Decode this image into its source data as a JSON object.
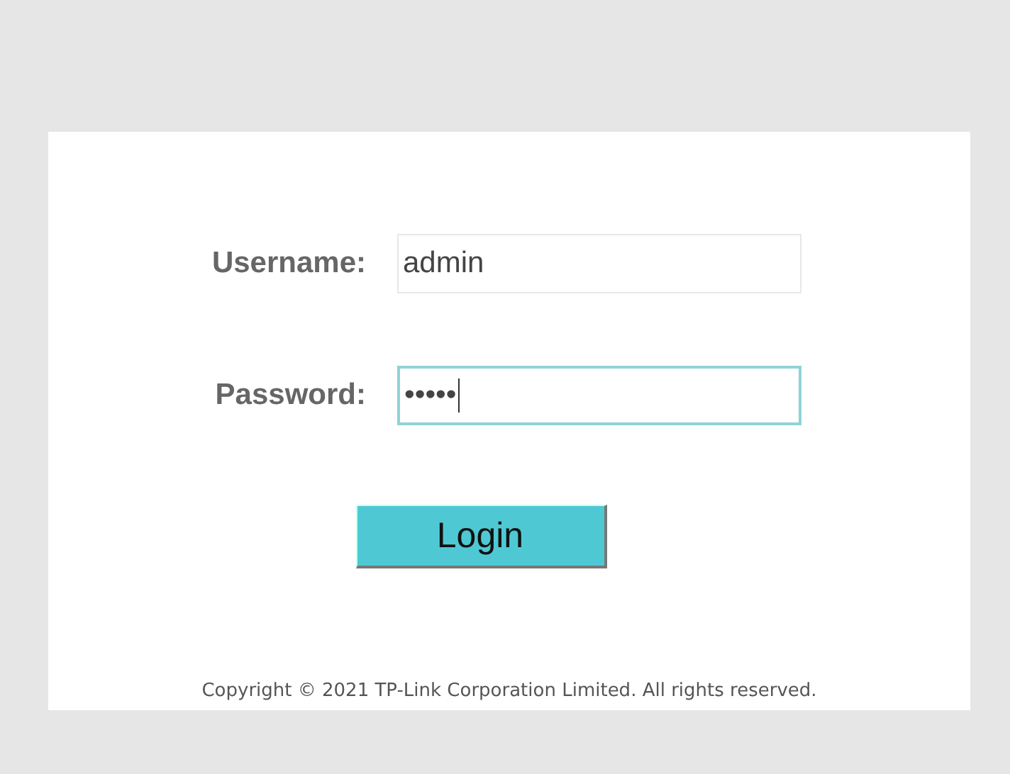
{
  "form": {
    "fields": [
      {
        "label": "Username:",
        "value": "admin",
        "focused": false
      },
      {
        "label": "Password:",
        "value": "•••••",
        "focused": true
      }
    ],
    "login_button": "Login"
  },
  "footer": "Copyright © 2021 TP-Link Corporation Limited. All rights reserved."
}
